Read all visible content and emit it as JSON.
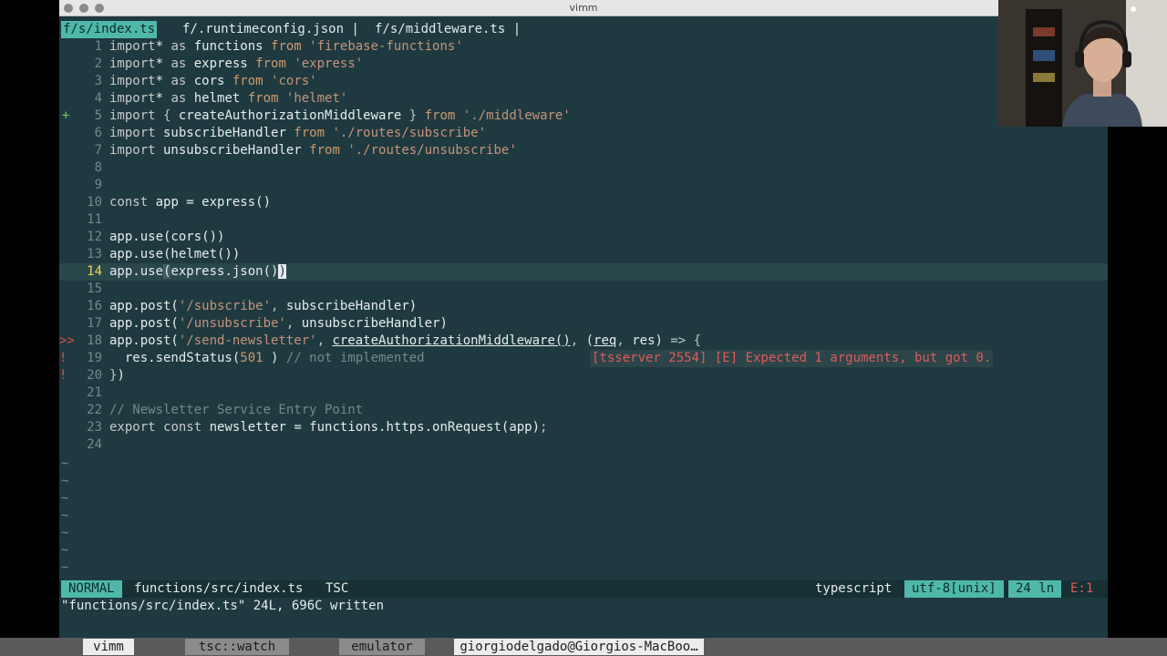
{
  "window": {
    "title": "vimm"
  },
  "tabs": [
    {
      "label": "f/s/index.ts",
      "active": true
    },
    {
      "label": "f/.runtimeconfig.json |",
      "active": false
    },
    {
      "label": "f/s/middleware.ts |",
      "active": false
    }
  ],
  "lines": [
    {
      "n": "1",
      "sign": "",
      "tokens": [
        [
          "kw",
          "import"
        ],
        [
          "",
          "* "
        ],
        [
          "kw",
          "as"
        ],
        [
          "",
          " functions "
        ],
        [
          "fr",
          "from"
        ],
        [
          "",
          " "
        ],
        [
          "str",
          "'firebase-functions'"
        ]
      ]
    },
    {
      "n": "2",
      "sign": "",
      "tokens": [
        [
          "kw",
          "import"
        ],
        [
          "",
          "* "
        ],
        [
          "kw",
          "as"
        ],
        [
          "",
          " express "
        ],
        [
          "fr",
          "from"
        ],
        [
          "",
          " "
        ],
        [
          "str",
          "'express'"
        ]
      ]
    },
    {
      "n": "3",
      "sign": "",
      "tokens": [
        [
          "kw",
          "import"
        ],
        [
          "",
          "* "
        ],
        [
          "kw",
          "as"
        ],
        [
          "",
          " cors "
        ],
        [
          "fr",
          "from"
        ],
        [
          "",
          " "
        ],
        [
          "str",
          "'cors'"
        ]
      ]
    },
    {
      "n": "4",
      "sign": "",
      "tokens": [
        [
          "kw",
          "import"
        ],
        [
          "",
          "* "
        ],
        [
          "kw",
          "as"
        ],
        [
          "",
          " helmet "
        ],
        [
          "fr",
          "from"
        ],
        [
          "",
          " "
        ],
        [
          "str",
          "'helmet'"
        ]
      ]
    },
    {
      "n": "5",
      "sign": "+",
      "tokens": [
        [
          "kw",
          "import"
        ],
        [
          "",
          " "
        ],
        [
          "pn",
          "{"
        ],
        [
          "",
          " createAuthorizationMiddleware "
        ],
        [
          "pn",
          "}"
        ],
        [
          "",
          " "
        ],
        [
          "fr",
          "from"
        ],
        [
          "",
          " "
        ],
        [
          "str",
          "'./middleware'"
        ]
      ]
    },
    {
      "n": "6",
      "sign": "",
      "tokens": [
        [
          "kw",
          "import"
        ],
        [
          "",
          " subscribeHandler "
        ],
        [
          "fr",
          "from"
        ],
        [
          "",
          " "
        ],
        [
          "str",
          "'./routes/subscribe'"
        ]
      ]
    },
    {
      "n": "7",
      "sign": "",
      "tokens": [
        [
          "kw",
          "import"
        ],
        [
          "",
          " unsubscribeHandler "
        ],
        [
          "fr",
          "from"
        ],
        [
          "",
          " "
        ],
        [
          "str",
          "'./routes/unsubscribe'"
        ]
      ]
    },
    {
      "n": "8",
      "sign": "",
      "tokens": []
    },
    {
      "n": "9",
      "sign": "",
      "tokens": []
    },
    {
      "n": "10",
      "sign": "",
      "tokens": [
        [
          "kw",
          "const"
        ],
        [
          "",
          " app = express()"
        ]
      ]
    },
    {
      "n": "11",
      "sign": "",
      "tokens": []
    },
    {
      "n": "12",
      "sign": "",
      "tokens": [
        [
          "",
          "app.use(cors())"
        ]
      ]
    },
    {
      "n": "13",
      "sign": "",
      "tokens": [
        [
          "",
          "app.use(helmet())"
        ]
      ]
    },
    {
      "n": "14",
      "sign": "",
      "current": true,
      "tokens": [
        [
          "",
          "app.use"
        ],
        [
          "match",
          "("
        ],
        [
          "",
          "express.json()"
        ],
        [
          "cursor",
          ")"
        ]
      ]
    },
    {
      "n": "15",
      "sign": "",
      "tokens": []
    },
    {
      "n": "16",
      "sign": "",
      "tokens": [
        [
          "",
          "app.post("
        ],
        [
          "str",
          "'/subscribe'"
        ],
        [
          "pn",
          ","
        ],
        [
          "",
          " subscribeHandler)"
        ]
      ]
    },
    {
      "n": "17",
      "sign": "",
      "tokens": [
        [
          "",
          "app.post("
        ],
        [
          "str",
          "'/unsubscribe'"
        ],
        [
          "pn",
          ","
        ],
        [
          "",
          " unsubscribeHandler)"
        ]
      ]
    },
    {
      "n": "18",
      "sign": ">>",
      "tokens": [
        [
          "",
          "app.post("
        ],
        [
          "str",
          "'/send-newsletter'"
        ],
        [
          "pn",
          ","
        ],
        [
          "",
          " "
        ],
        [
          "und",
          "createAuthorizationMiddleware()"
        ],
        [
          "pn",
          ","
        ],
        [
          "",
          " ("
        ],
        [
          "und",
          "req"
        ],
        [
          "pn",
          ","
        ],
        [
          "",
          " res) "
        ],
        [
          "pn",
          "=>"
        ],
        [
          "",
          " "
        ],
        [
          "pn",
          "{"
        ]
      ]
    },
    {
      "n": "19",
      "sign": "!",
      "tokens": [
        [
          "",
          "  res.sendStatus("
        ],
        [
          "num",
          "501"
        ],
        [
          "",
          " ) "
        ],
        [
          "cmt",
          "// not implemented"
        ]
      ]
    },
    {
      "n": "20",
      "sign": "!",
      "tokens": [
        [
          "pn",
          "}"
        ],
        [
          "",
          ")"
        ]
      ]
    },
    {
      "n": "21",
      "sign": "",
      "tokens": []
    },
    {
      "n": "22",
      "sign": "",
      "tokens": [
        [
          "cmt",
          "// Newsletter Service Entry Point"
        ]
      ]
    },
    {
      "n": "23",
      "sign": "",
      "tokens": [
        [
          "kw",
          "export"
        ],
        [
          "",
          " "
        ],
        [
          "kw",
          "const"
        ],
        [
          "",
          " newsletter = functions.https.onRequest(app)"
        ],
        [
          "pn",
          ";"
        ]
      ]
    },
    {
      "n": "24",
      "sign": "",
      "tokens": []
    }
  ],
  "diagnostic": {
    "text": "[tsserver 2554] [E] Expected 1 arguments, but got 0."
  },
  "tilde_count": 7,
  "tilde_char": "~",
  "statusline": {
    "mode": "NORMAL",
    "file": "functions/src/index.ts",
    "linter": "TSC",
    "filetype": "typescript",
    "encoding": "utf-8[unix]",
    "lines": "24 ln",
    "errors": "E:1"
  },
  "cmdline": "\"functions/src/index.ts\" 24L, 696C written",
  "tmux": {
    "windows": [
      "vimm",
      "tsc::watch",
      "emulator"
    ],
    "host": "giorgiodelgado@Giorgios-MacBoo…"
  }
}
